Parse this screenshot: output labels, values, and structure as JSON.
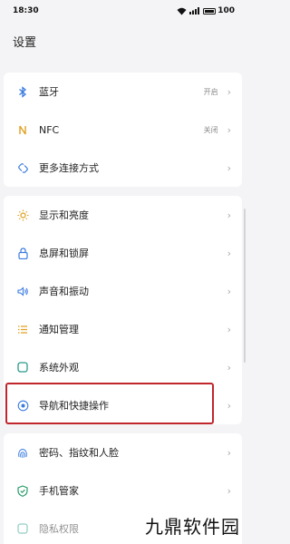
{
  "status_bar": {
    "time": "18:30",
    "battery": "100"
  },
  "page_title": "设置",
  "groups": [
    {
      "items": [
        {
          "label": "蓝牙",
          "value": "开启",
          "icon": "bluetooth-icon"
        },
        {
          "label": "NFC",
          "value": "关闭",
          "icon": "nfc-icon"
        },
        {
          "label": "更多连接方式",
          "value": "",
          "icon": "link-icon"
        }
      ]
    },
    {
      "items": [
        {
          "label": "显示和亮度",
          "icon": "brightness-icon"
        },
        {
          "label": "息屏和锁屏",
          "icon": "lock-icon"
        },
        {
          "label": "声音和振动",
          "icon": "sound-icon"
        },
        {
          "label": "通知管理",
          "icon": "notification-icon"
        },
        {
          "label": "系统外观",
          "icon": "appearance-icon"
        },
        {
          "label": "导航和快捷操作",
          "icon": "navigation-icon"
        }
      ]
    },
    {
      "items": [
        {
          "label": "密码、指纹和人脸",
          "icon": "fingerprint-icon"
        },
        {
          "label": "手机管家",
          "icon": "shield-icon"
        },
        {
          "label": "隐私权限",
          "icon": "privacy-icon"
        }
      ]
    }
  ],
  "watermark": "九鼎软件园",
  "colors": {
    "accent": "#3a7be0",
    "highlight": "#c0262c",
    "nfc": "#e0a020",
    "shield": "#2a9a6a"
  }
}
